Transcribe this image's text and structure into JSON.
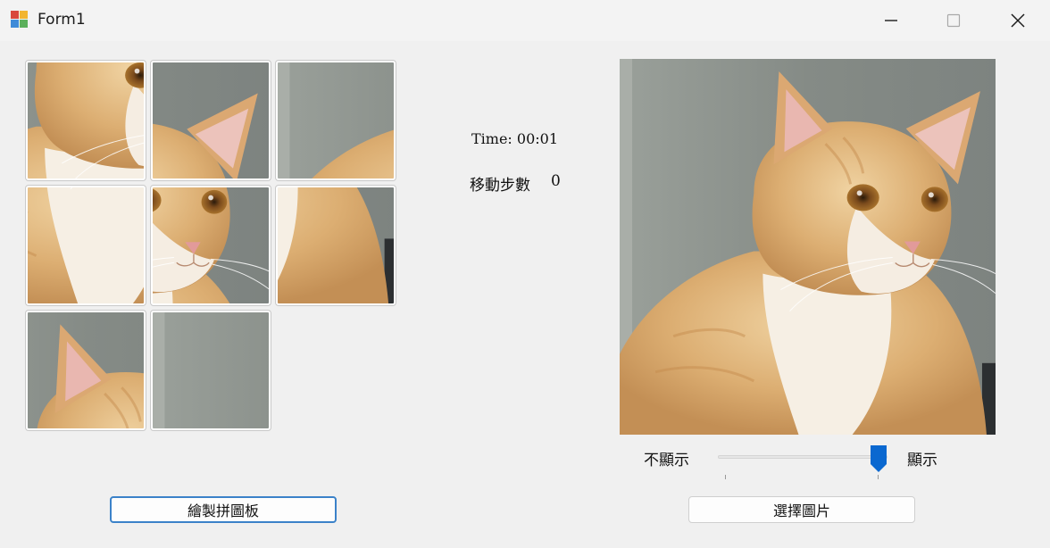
{
  "window": {
    "title": "Form1",
    "minimize_icon": "minimize-icon",
    "maximize_icon": "maximize-icon",
    "close_icon": "close-icon"
  },
  "puzzle": {
    "grid": "3x3",
    "tiles": [
      {
        "piece": 4
      },
      {
        "piece": 2
      },
      {
        "piece": 3
      },
      {
        "piece": 7
      },
      {
        "piece": 5
      },
      {
        "piece": 8
      },
      {
        "piece": 1
      },
      {
        "piece": 0
      },
      {
        "piece": null
      }
    ]
  },
  "status": {
    "time_text": "Time: 00:01",
    "moves_label": "移動步數",
    "moves_value": "0"
  },
  "preview": {
    "hide_label": "不顯示",
    "show_label": "顯示",
    "slider_value": 1.0
  },
  "buttons": {
    "draw_board": "繪製拼圖板",
    "choose_image": "選擇圖片"
  },
  "colors": {
    "focus_border": "#3b82c9",
    "slider_thumb": "#0a68d0"
  }
}
